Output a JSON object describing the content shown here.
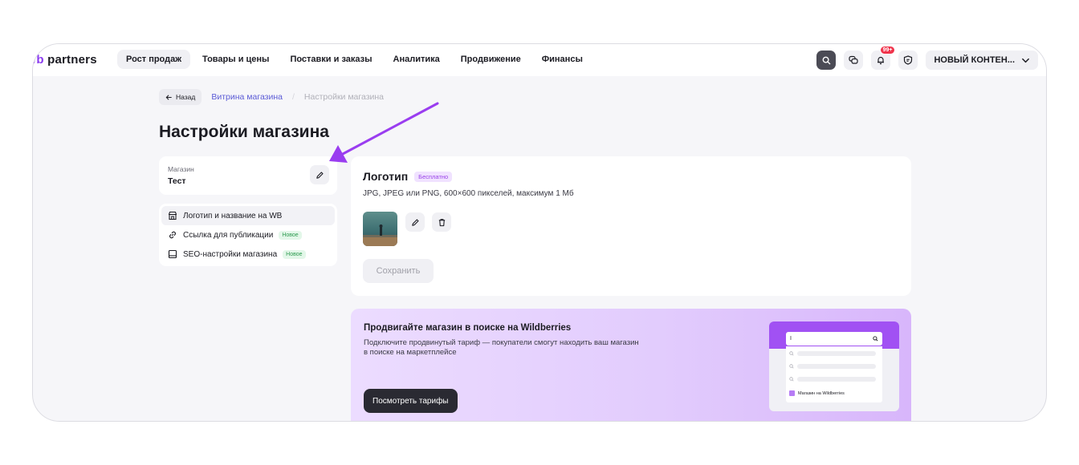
{
  "app": {
    "logo_mark": "/b",
    "logo_text": "partners"
  },
  "nav": {
    "items": [
      {
        "label": "Рост продаж",
        "active": true
      },
      {
        "label": "Товары и цены",
        "active": false
      },
      {
        "label": "Поставки и заказы",
        "active": false
      },
      {
        "label": "Аналитика",
        "active": false
      },
      {
        "label": "Продвижение",
        "active": false
      },
      {
        "label": "Финансы",
        "active": false
      }
    ],
    "notifications_count": "99+",
    "account_label": "НОВЫЙ КОНТЕН..."
  },
  "breadcrumb": {
    "back_label": "Назад",
    "parent": "Витрина магазина",
    "current": "Настройки магазина"
  },
  "page": {
    "title": "Настройки магазина"
  },
  "store": {
    "label": "Магазин",
    "name": "Тест"
  },
  "menu": {
    "items": [
      {
        "label": "Логотип и название на WB",
        "icon": "store-icon",
        "badge": ""
      },
      {
        "label": "Ссылка для публикации",
        "icon": "link-icon",
        "badge": "Новое"
      },
      {
        "label": "SEO-настройки магазина",
        "icon": "seo-icon",
        "badge": "Новое"
      }
    ]
  },
  "logo_card": {
    "title": "Логотип",
    "badge": "Бесплатно",
    "description": "JPG, JPEG или PNG, 600×600 пикселей, максимум 1 Мб",
    "save_label": "Сохранить"
  },
  "promo": {
    "title": "Продвигайте магазин в поиске на Wildberries",
    "description": "Подключите продвинутый тариф — покупатели смогут находить ваш магазин в поиске на маркетплейсе",
    "button_label": "Посмотреть тарифы",
    "mock_search_value": "I",
    "mock_result_label": "Магазин на Wildberries"
  },
  "colors": {
    "accent": "#8b3cf0",
    "link": "#5b5bd6",
    "badge_red": "#f0334b",
    "promo_bg": "#e2ccfd",
    "arrow": "#9a3df0"
  }
}
